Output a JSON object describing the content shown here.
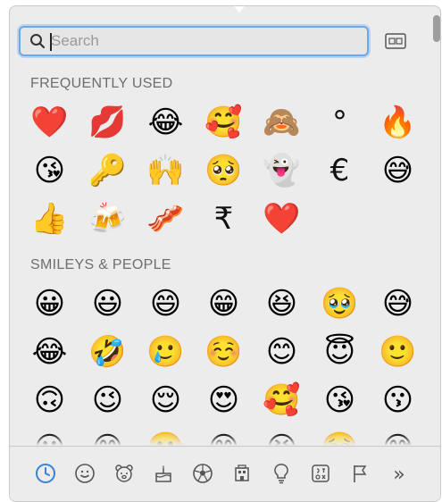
{
  "search": {
    "placeholder": "Search",
    "value": ""
  },
  "sections": [
    {
      "title": "FREQUENTLY USED",
      "items": [
        "❤️",
        "💋",
        "😂",
        "🥰",
        "🙈",
        "°",
        "🔥",
        "😘",
        "🔑",
        "🙌",
        "🥺",
        "👻",
        "€",
        "😅",
        "👍",
        "🍻",
        "🥓",
        "₹",
        "❤️"
      ]
    },
    {
      "title": "SMILEYS & PEOPLE",
      "items": [
        "😀",
        "😃",
        "😄",
        "😁",
        "😆",
        "🥹",
        "😅",
        "😂",
        "🤣",
        "🥲",
        "☺️",
        "😊",
        "😇",
        "🙂",
        "🙃",
        "😉",
        "😌",
        "😍",
        "🥰",
        "😘",
        "😗",
        "😀",
        "😄",
        "🙂",
        "😁",
        "😆",
        "🥹",
        "😅"
      ]
    }
  ],
  "categories": [
    {
      "name": "recently-used",
      "icon": "clock-icon",
      "active": true
    },
    {
      "name": "smileys-people",
      "icon": "smiley-icon"
    },
    {
      "name": "animals-nature",
      "icon": "bear-icon"
    },
    {
      "name": "food-drink",
      "icon": "cake-icon"
    },
    {
      "name": "activity",
      "icon": "soccer-ball-icon"
    },
    {
      "name": "travel-places",
      "icon": "building-icon"
    },
    {
      "name": "objects",
      "icon": "lightbulb-icon"
    },
    {
      "name": "symbols",
      "icon": "symbols-icon"
    },
    {
      "name": "flags",
      "icon": "flag-icon"
    },
    {
      "name": "more",
      "icon": "double-chevron-icon",
      "label": "»"
    }
  ],
  "colors": {
    "accent": "#3b82d6",
    "search_border": "#6fa8e6",
    "panel": "#ececec"
  }
}
